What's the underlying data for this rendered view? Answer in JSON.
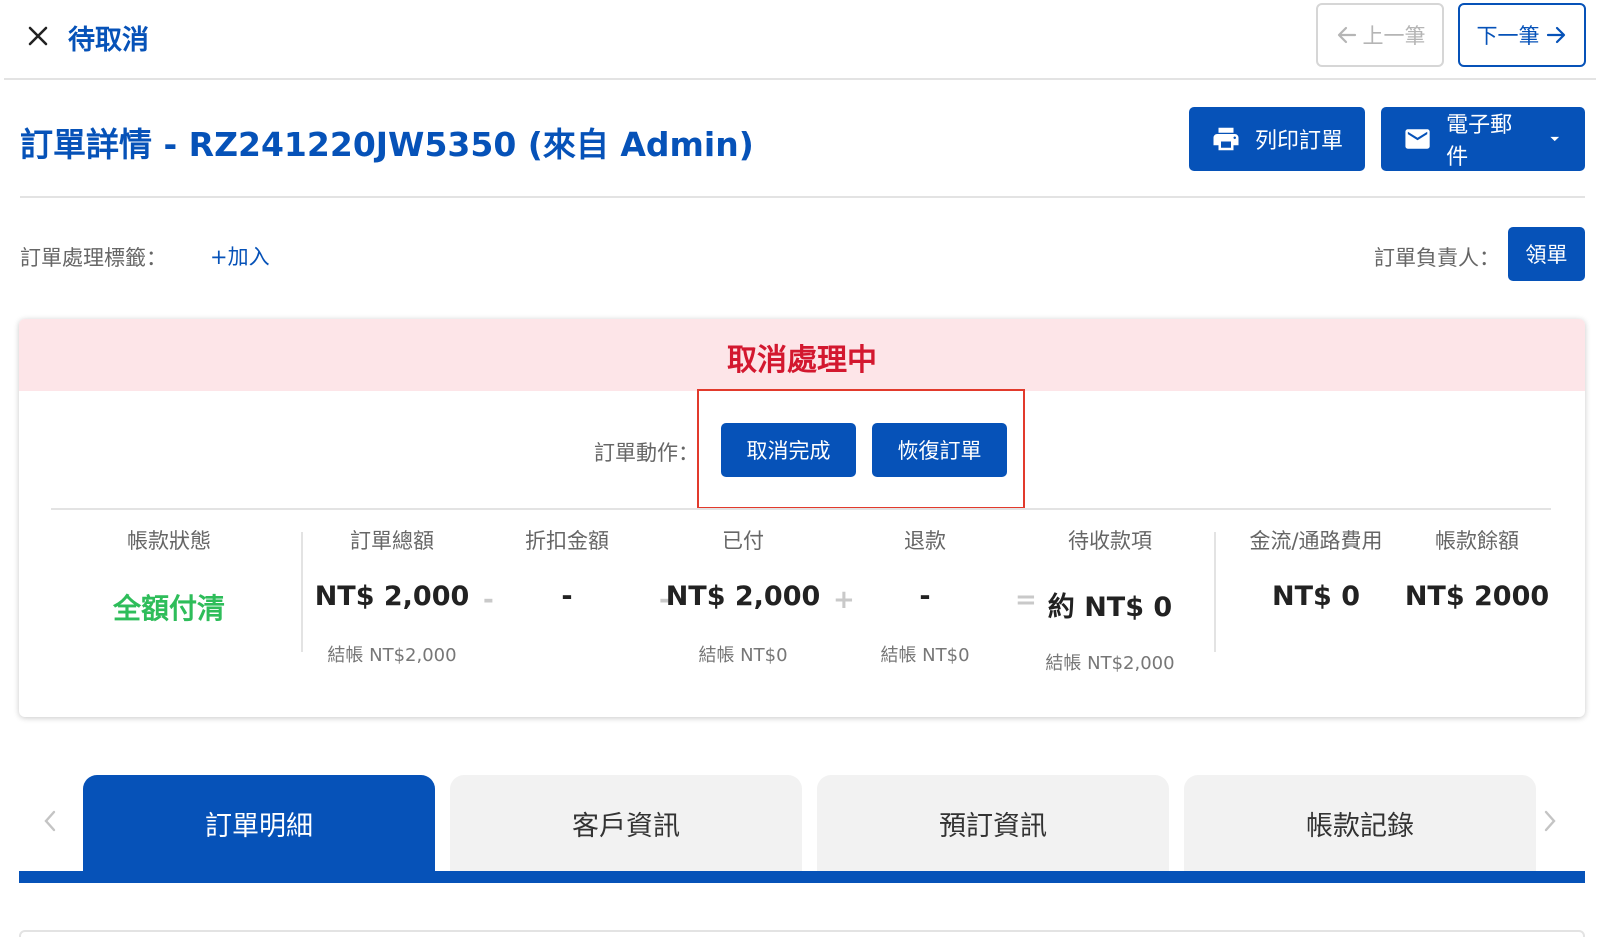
{
  "topbar": {
    "title": "待取消",
    "prev_label": "上一筆",
    "next_label": "下一筆"
  },
  "header": {
    "title": "訂單詳情  - RZ241220JW5350 (來自 Admin)",
    "print_label": "列印訂單",
    "email_label": "電子郵件"
  },
  "tags": {
    "label": "訂單處理標籤：",
    "add_label": "+加入",
    "owner_label": "訂單負責人：",
    "claim_label": "領單"
  },
  "status_card": {
    "status": "取消處理中",
    "actions_label": "訂單動作：",
    "cancel_complete_label": "取消完成",
    "restore_label": "恢復訂單",
    "summary": {
      "payment_status_label": "帳款狀態",
      "payment_status_value": "全額付清",
      "total_label": "訂單總額",
      "total_value": "NT$ 2,000",
      "total_sub": "結帳 NT$2,000",
      "discount_label": "折扣金額",
      "discount_value": "-",
      "paid_label": "已付",
      "paid_value": "NT$ 2,000",
      "paid_sub": "結帳 NT$0",
      "refund_label": "退款",
      "refund_value": "-",
      "refund_sub": "結帳 NT$0",
      "receivable_label": "待收款項",
      "receivable_value": "約 NT$ 0",
      "receivable_sub": "結帳 NT$2,000",
      "fee_label": "金流/通路費用",
      "fee_value": "NT$ 0",
      "balance_label": "帳款餘額",
      "balance_value": "NT$ 2000",
      "op_minus": "-",
      "op_plus": "+",
      "op_equals": "="
    }
  },
  "tabs": [
    {
      "label": "訂單明細"
    },
    {
      "label": "客戶資訊"
    },
    {
      "label": "預訂資訊"
    },
    {
      "label": "帳款記錄"
    }
  ],
  "colors": {
    "brand": "#0652b8",
    "danger": "#d3182f",
    "success": "#2ebd5a",
    "banner_bg": "#fde5e8"
  }
}
